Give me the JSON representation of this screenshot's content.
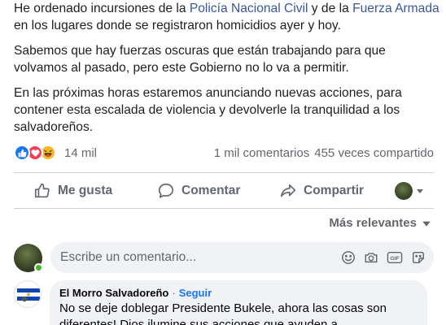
{
  "post": {
    "p1_pre": "He ordenado incursiones de la ",
    "p1_link1": "Policía Nacional Civil",
    "p1_mid": " y de la ",
    "p1_link2": "Fuerza Armada",
    "p1_post": " en los lugares donde se registraron homicidios ayer y hoy.",
    "p2": "Sabemos que hay fuerzas oscuras que están trabajando para que volvamos al pasado, pero este Gobierno no lo va a permitir.",
    "p3": "En las próximas horas estaremos anunciando nuevas acciones, para contener esta escalada de violencia y devolverle la tranquilidad a los salvadoreños."
  },
  "stats": {
    "reaction_icons": [
      "like-reaction",
      "love-reaction",
      "haha-reaction"
    ],
    "reaction_count": "14 mil",
    "comments": "1 mil comentarios",
    "shares": "455 veces compartido"
  },
  "actions": {
    "like": "Me gusta",
    "comment": "Comentar",
    "share": "Compartir"
  },
  "sort": {
    "label": "Más relevantes"
  },
  "composer": {
    "placeholder": "Escribe un comentario..."
  },
  "comment": {
    "author": "El Morro Salvadoreño",
    "separator": "·",
    "follow": "Seguir",
    "text": "No se deje doblegar Presidente Bukele, ahora las cosas son diferentes! Dios ilumine sus acciones que ayuden a"
  },
  "colors": {
    "link": "#385898",
    "like_blue": "#1877f2",
    "love_red": "#f33e58",
    "haha_yellow": "#f7b928",
    "online_green": "#42b72a"
  }
}
